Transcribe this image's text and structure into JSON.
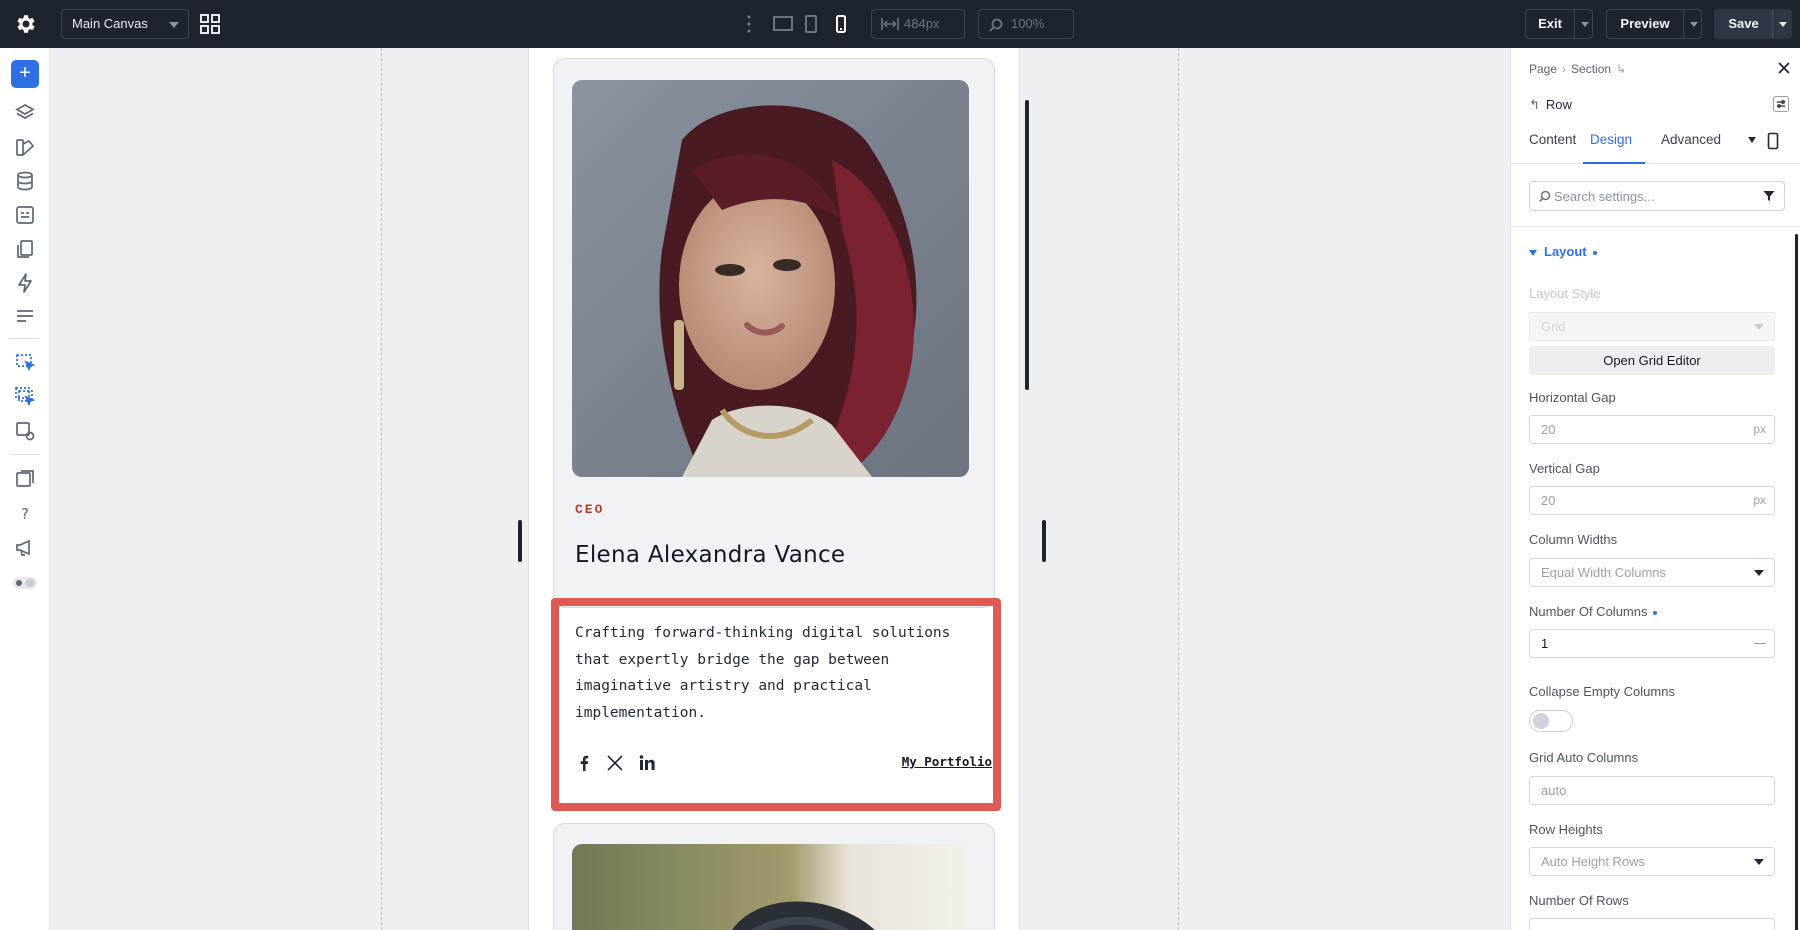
{
  "toolbar": {
    "canvas_select": "Main Canvas",
    "width_value": "484px",
    "zoom_value": "100%",
    "exit_label": "Exit",
    "preview_label": "Preview",
    "save_label": "Save"
  },
  "card": {
    "role": "CEO",
    "name": "Elena Alexandra Vance",
    "bio": "Crafting forward-thinking digital solutions that expertly bridge the gap between imaginative artistry and practical implementation.",
    "portfolio_link": "My Portfolio"
  },
  "panel": {
    "breadcrumb": [
      "Page",
      "Section"
    ],
    "element": "Row",
    "tabs": [
      "Content",
      "Design",
      "Advanced"
    ],
    "active_tab": "Design",
    "search_placeholder": "Search settings...",
    "section_title": "Layout",
    "fields": {
      "layout_style_label": "Layout Style",
      "layout_style_value": "Grid",
      "open_grid_editor": "Open Grid Editor",
      "horizontal_gap_label": "Horizontal Gap",
      "horizontal_gap_value": "20",
      "horizontal_gap_unit": "px",
      "vertical_gap_label": "Vertical Gap",
      "vertical_gap_value": "20",
      "vertical_gap_unit": "px",
      "column_widths_label": "Column Widths",
      "column_widths_value": "Equal Width Columns",
      "num_columns_label": "Number Of Columns",
      "num_columns_value": "1",
      "collapse_label": "Collapse Empty Columns",
      "grid_auto_columns_label": "Grid Auto Columns",
      "grid_auto_columns_placeholder": "auto",
      "row_heights_label": "Row Heights",
      "row_heights_value": "Auto Height Rows",
      "num_rows_label": "Number Of Rows"
    }
  },
  "colors": {
    "accent": "#2e6fe6",
    "topbar": "#1e2330",
    "highlight": "#e05a55",
    "role": "#b3402f"
  }
}
